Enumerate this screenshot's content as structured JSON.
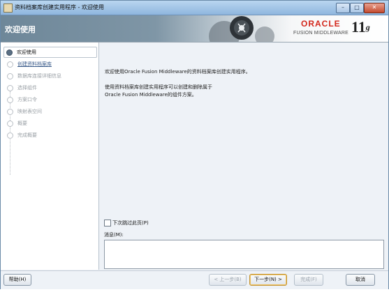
{
  "titlebar": {
    "title": "资料档案库创建实用程序 - 欢迎使用",
    "minimize_icon": "minimize-icon",
    "maximize_icon": "maximize-icon",
    "close_icon": "close-icon"
  },
  "header": {
    "title": "欢迎使用",
    "brand_oracle": "ORACLE",
    "brand_product": "FUSION MIDDLEWARE",
    "version": "11",
    "version_suffix": "g"
  },
  "steps": [
    {
      "label": "欢迎使用",
      "state": "active"
    },
    {
      "label": "创建资料档案库",
      "state": "link"
    },
    {
      "label": "数据库连接详细信息",
      "state": "disabled"
    },
    {
      "label": "选择组件",
      "state": "disabled"
    },
    {
      "label": "方案口令",
      "state": "disabled"
    },
    {
      "label": "映射表空间",
      "state": "disabled"
    },
    {
      "label": "概要",
      "state": "disabled"
    },
    {
      "label": "完成概要",
      "state": "disabled"
    }
  ],
  "main": {
    "welcome": "欢迎使用Oracle Fusion Middleware的资料档案库创建实用程序。",
    "description": "使用资料档案库创建实用程序可以创建和删除属于\nOracle Fusion Middleware的组件方案。",
    "skip_label": "下次跳过此页(P)",
    "skip_checked": false,
    "messages_label": "消息(M):",
    "messages_value": ""
  },
  "footer": {
    "help": "帮助(H)",
    "back": "< 上一步(B)",
    "next": "下一步(N) >",
    "finish": "完成(F)",
    "cancel": "取消"
  }
}
